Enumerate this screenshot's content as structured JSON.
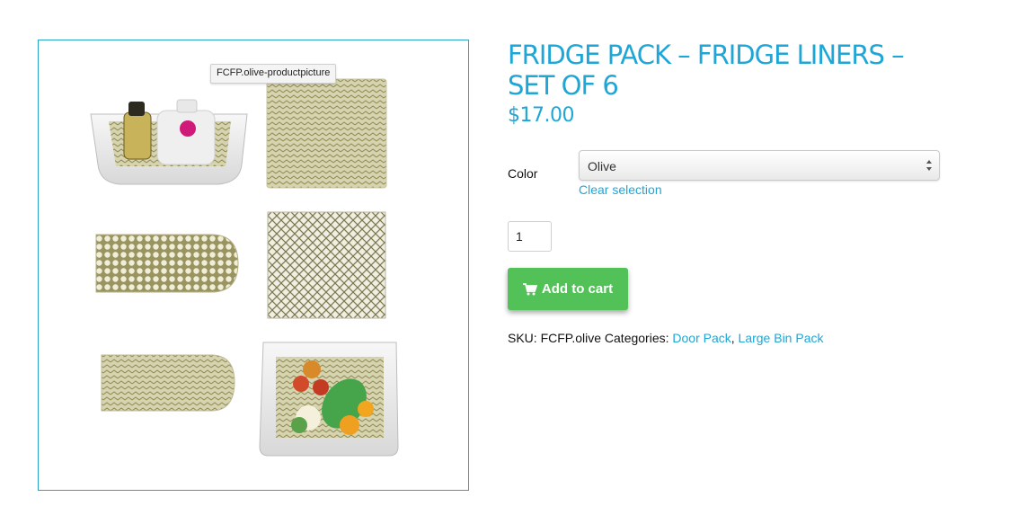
{
  "gallery": {
    "tooltip": "FCFP.olive-productpicture"
  },
  "product": {
    "title": "FRIDGE PACK – FRIDGE LINERS – SET OF 6",
    "price": "$17.00"
  },
  "variations": {
    "color_label": "Color",
    "color_selected": "Olive",
    "clear_label": "Clear selection"
  },
  "quantity": "1",
  "add_to_cart": {
    "label": "Add to cart",
    "icon": "cart-icon"
  },
  "meta": {
    "sku_label": "SKU:",
    "sku_value": "FCFP.olive",
    "categories_label": "Categories:",
    "categories": [
      "Door Pack",
      "Large Bin Pack"
    ],
    "separator": ", "
  },
  "colors": {
    "accent": "#1ea6d6",
    "button": "#52c258",
    "liner": "#d9d7b7",
    "liner_pattern": "#8f8a52"
  }
}
